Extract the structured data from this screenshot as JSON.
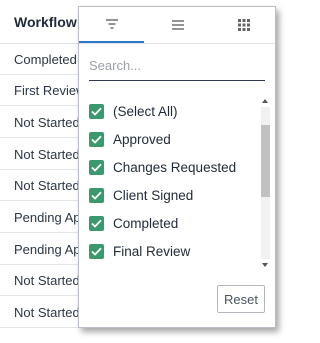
{
  "grid": {
    "column_header": "Workflow",
    "rows": [
      "Completed",
      "First Review",
      "Not Started",
      "Not Started",
      "Not Started",
      "Pending Ap",
      "Pending Ap",
      "Not Started",
      "Not Started"
    ]
  },
  "filter_menu": {
    "tabs": [
      {
        "icon": "filter-icon",
        "active": true
      },
      {
        "icon": "menu-icon",
        "active": false
      },
      {
        "icon": "columns-grid-icon",
        "active": false
      }
    ],
    "search": {
      "placeholder": "Search...",
      "value": ""
    },
    "items": [
      {
        "label": "(Select All)",
        "checked": true
      },
      {
        "label": "Approved",
        "checked": true
      },
      {
        "label": "Changes Requested",
        "checked": true
      },
      {
        "label": "Client Signed",
        "checked": true
      },
      {
        "label": "Completed",
        "checked": true
      },
      {
        "label": "Final Review",
        "checked": true
      }
    ],
    "reset_label": "Reset"
  },
  "colors": {
    "accent": "#2b78c5",
    "checkbox": "#3a9a6e"
  }
}
